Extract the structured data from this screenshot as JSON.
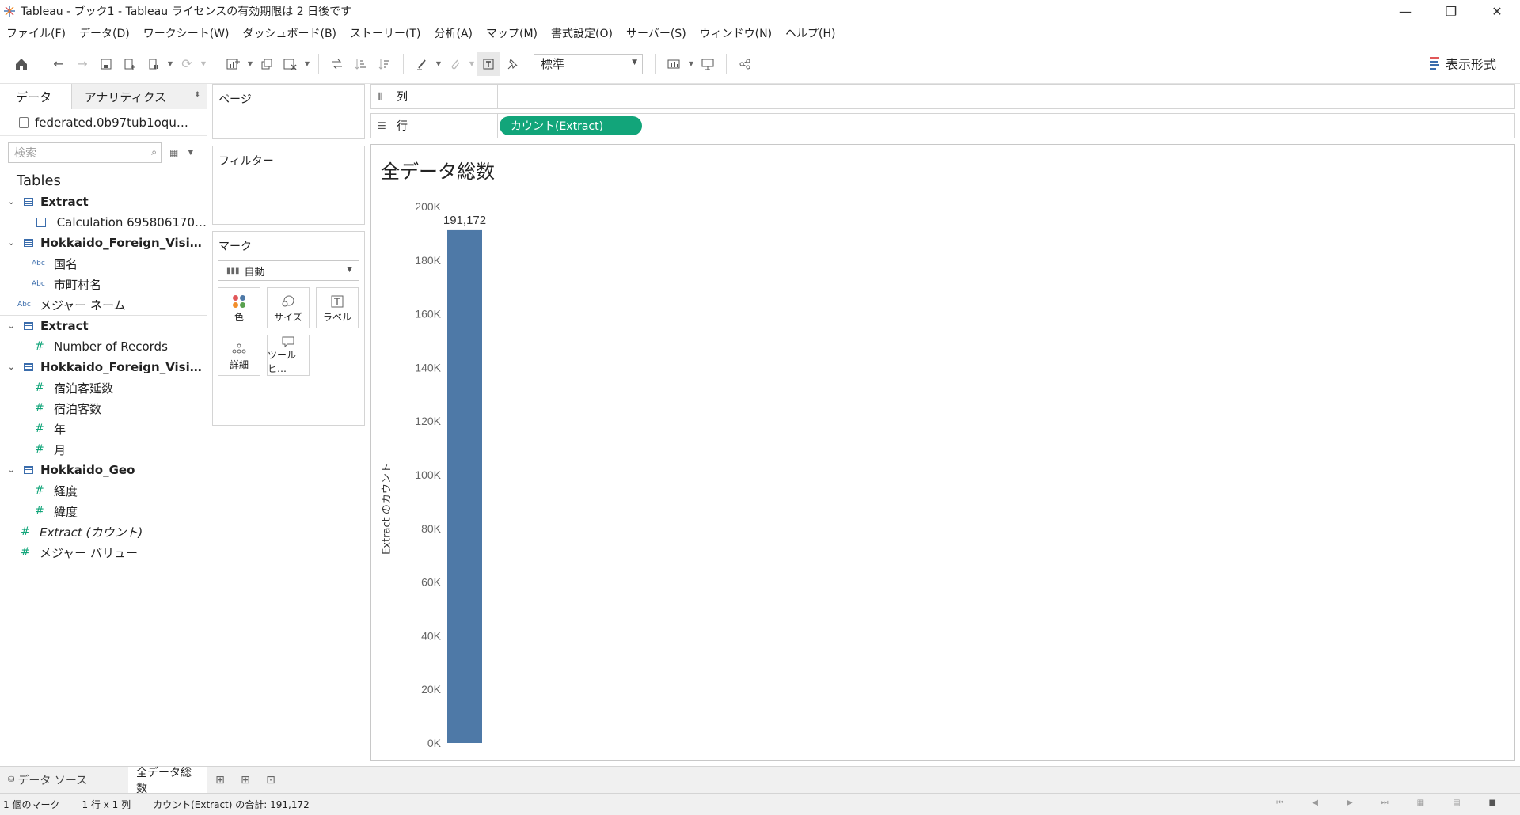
{
  "window": {
    "title": "Tableau - ブック1 - Tableau ライセンスの有効期限は 2 日後です",
    "minimize": "—",
    "restore": "❐",
    "close": "✕"
  },
  "menu": [
    "ファイル(F)",
    "データ(D)",
    "ワークシート(W)",
    "ダッシュボード(B)",
    "ストーリー(T)",
    "分析(A)",
    "マップ(M)",
    "書式設定(O)",
    "サーバー(S)",
    "ウィンドウ(N)",
    "ヘルプ(H)"
  ],
  "toolbar": {
    "fit": "標準",
    "show_me": "表示形式"
  },
  "data_pane": {
    "tab_data": "データ",
    "tab_analytics": "アナリティクス",
    "datasource": "federated.0b97tub1oqu…",
    "search_placeholder": "検索",
    "tables_header": "Tables",
    "items": [
      "Extract",
      "Calculation 695806170…",
      "Hokkaido_Foreign_Visi…",
      "国名",
      "市町村名",
      "メジャー ネーム",
      "Extract",
      "Number of Records",
      "Hokkaido_Foreign_Visi…",
      "宿泊客延数",
      "宿泊客数",
      "年",
      "月",
      "Hokkaido_Geo",
      "経度",
      "緯度",
      "Extract (カウント)",
      "メジャー バリュー"
    ]
  },
  "cards": {
    "pages": "ページ",
    "filters": "フィルター",
    "marks": "マーク",
    "mark_type": "自動",
    "color": "色",
    "size": "サイズ",
    "label": "ラベル",
    "detail": "詳細",
    "tooltip": "ツールヒ…"
  },
  "shelves": {
    "columns": "列",
    "rows": "行",
    "row_pill": "カウント(Extract)"
  },
  "viz": {
    "title": "全データ総数",
    "y_axis_title": "Extract のカウント"
  },
  "chart_data": {
    "type": "bar",
    "categories": [
      ""
    ],
    "values": [
      191172
    ],
    "data_labels": [
      "191,172"
    ],
    "ylabel": "Extract のカウント",
    "ylim": [
      0,
      200000
    ],
    "ticks": [
      "0K",
      "20K",
      "40K",
      "60K",
      "80K",
      "100K",
      "120K",
      "140K",
      "160K",
      "180K",
      "200K"
    ],
    "bar_color": "#4e79a7",
    "grid": false
  },
  "sheet_tabs": {
    "datasource": "データ ソース",
    "sheet1": "全データ総数"
  },
  "status": {
    "marks": "1 個のマーク",
    "rows_cols": "1 行 x 1 列",
    "sum": "カウント(Extract) の合計: 191,172"
  }
}
